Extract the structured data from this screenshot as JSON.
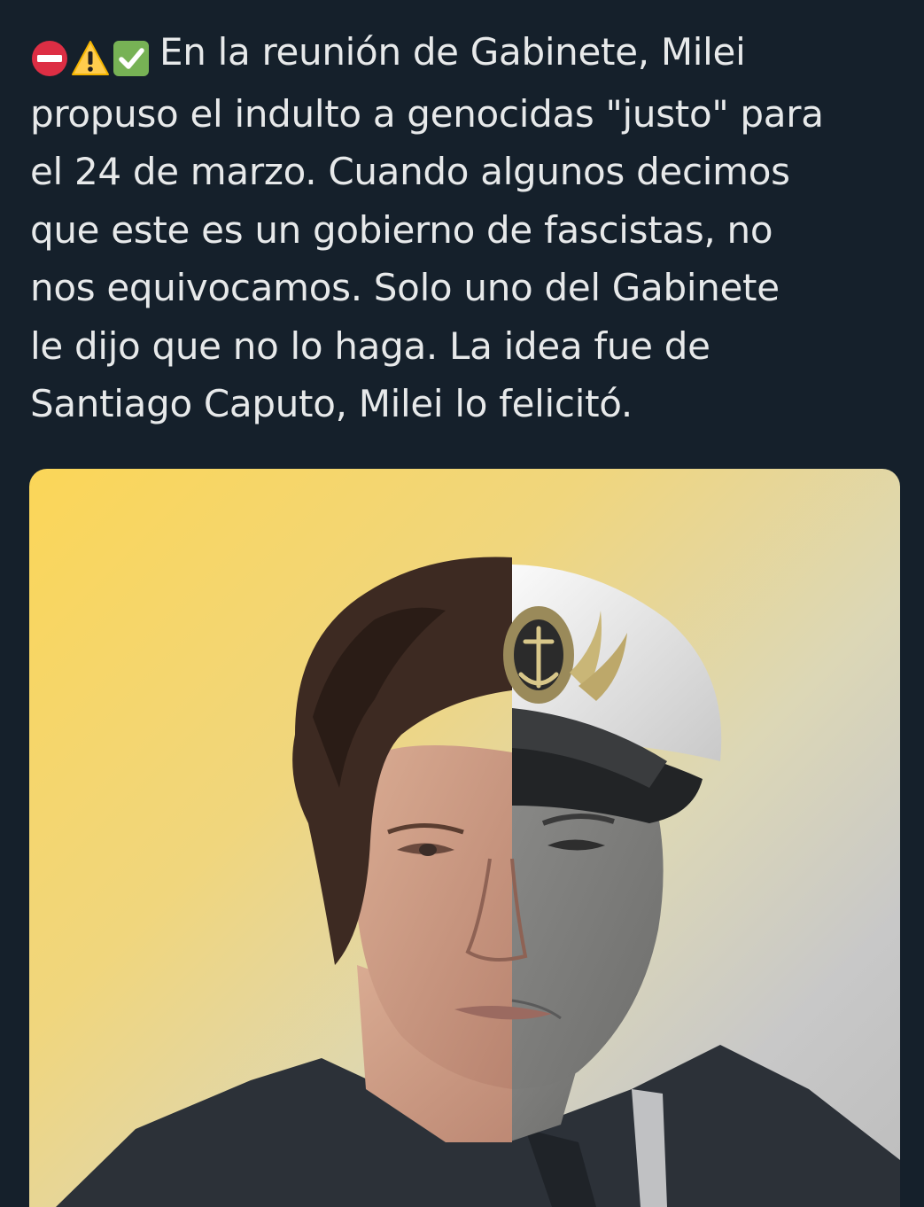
{
  "tweet": {
    "status_emojis": [
      "no-entry-icon",
      "warning-icon",
      "check-mark-button-icon"
    ],
    "lines": [
      "En la reunión de Gabinete, Milei",
      "propuso el indulto a genocidas \"justo\" para",
      "el 24 de marzo. Cuando algunos decimos",
      "que este es un gobierno de fascistas, no",
      "nos equivocamos. Solo uno del Gabinete",
      "le dijo que no lo haga. La idea fue de",
      "Santiago Caputo, Milei lo felicitó."
    ]
  },
  "media": {
    "description_icon": "composite-portrait-image",
    "colors": {
      "background": "#15202b",
      "text": "#e7e9ea",
      "gradient_yellow": "#fbd658",
      "gradient_gray": "#bdbdbd"
    }
  }
}
